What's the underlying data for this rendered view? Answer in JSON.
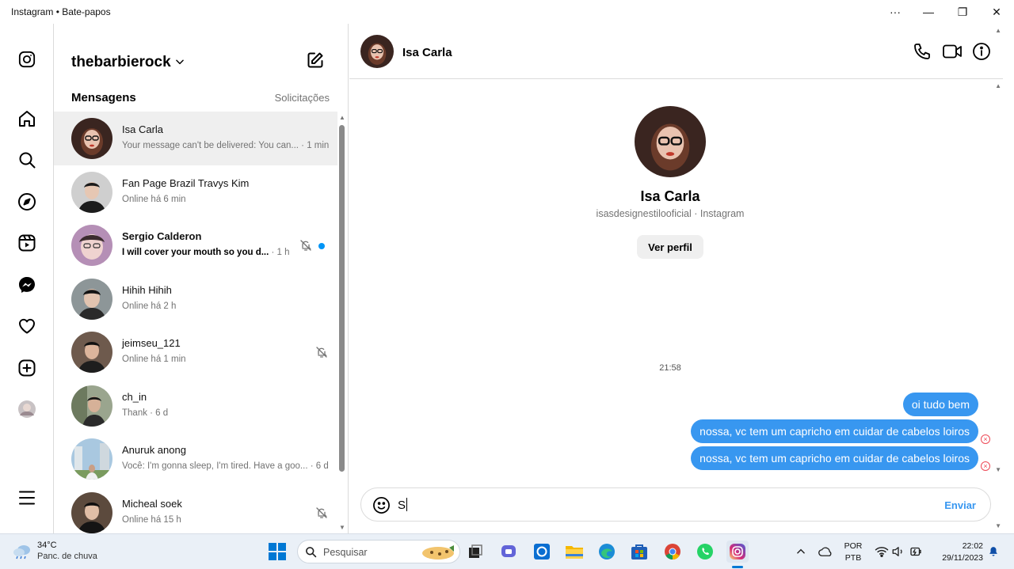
{
  "window": {
    "title": "Instagram • Bate-papos",
    "more": "···",
    "minimize": "—",
    "restore": "❐",
    "close": "✕"
  },
  "nav": [
    "instagram-icon",
    "home-icon",
    "search-icon",
    "explore-icon",
    "reels-icon",
    "messenger-icon",
    "heart-icon",
    "create-icon",
    "profile-avatar",
    "menu-icon"
  ],
  "sidebar": {
    "account": "thebarbierock",
    "tab_messages": "Mensagens",
    "tab_requests": "Solicitações",
    "conversations": [
      {
        "name": "Isa Carla",
        "preview": "Your message can't be delivered: You can... · 1 min",
        "bold": false,
        "active": true,
        "muted": false,
        "unread": false
      },
      {
        "name": "Fan Page Brazil Travys Kim",
        "preview": "Online há 6 min",
        "bold": false,
        "active": false,
        "muted": false,
        "unread": false
      },
      {
        "name": "Sergio Calderon",
        "preview": "I will cover your mouth so you d...",
        "meta": " · 1 h",
        "bold": true,
        "active": false,
        "muted": true,
        "unread": true
      },
      {
        "name": "Hihih Hihih",
        "preview": "Online há 2 h",
        "bold": false,
        "active": false,
        "muted": false,
        "unread": false
      },
      {
        "name": "jeimseu_121",
        "preview": "Online há 1 min",
        "bold": false,
        "active": false,
        "muted": true,
        "unread": false
      },
      {
        "name": "ch_in",
        "preview": "Thank · 6 d",
        "bold": false,
        "active": false,
        "muted": false,
        "unread": false
      },
      {
        "name": "Anuruk anong",
        "preview": "Você: I'm gonna sleep, I'm tired. Have a goo... · 6 d",
        "bold": false,
        "active": false,
        "muted": false,
        "unread": false
      },
      {
        "name": "Micheal soek",
        "preview": "Online há 15 h",
        "bold": false,
        "active": false,
        "muted": true,
        "unread": false
      }
    ]
  },
  "chat": {
    "name": "Isa Carla",
    "profile_name": "Isa Carla",
    "profile_sub": "isasdesignestilooficial · Instagram",
    "view_profile": "Ver perfil",
    "timestamp": "21:58",
    "messages": [
      {
        "text": "oi tudo bem",
        "failed": false
      },
      {
        "text": "nossa, vc tem um capricho em cuidar de cabelos loiros",
        "failed": true
      },
      {
        "text": "nossa, vc tem um capricho em cuidar de cabelos loiros",
        "failed": true
      }
    ],
    "composer_value": "S",
    "send_label": "Enviar",
    "error_glyph": "×"
  },
  "taskbar": {
    "temp": "34°C",
    "weather": "Panc. de chuva",
    "search_placeholder": "Pesquisar",
    "lang_1": "POR",
    "lang_2": "PTB",
    "time": "22:02",
    "date": "29/11/2023",
    "accent": "#0078d4"
  }
}
